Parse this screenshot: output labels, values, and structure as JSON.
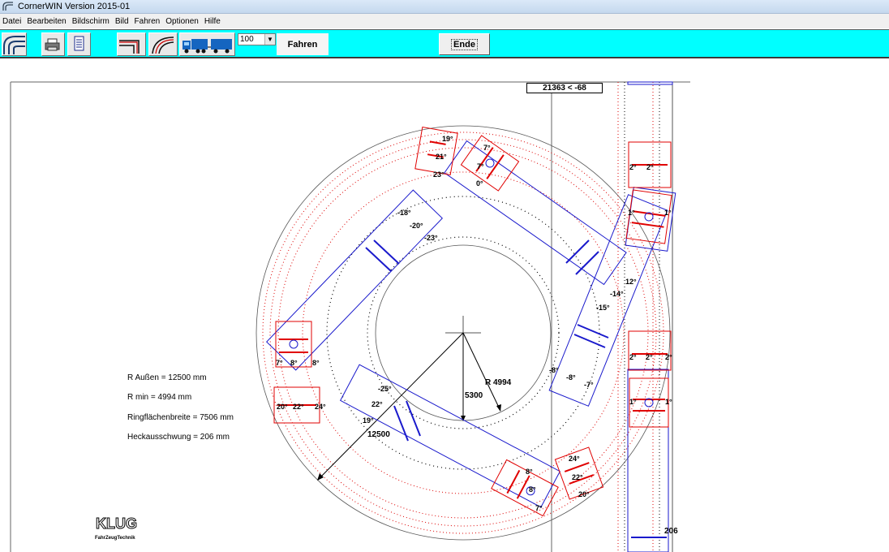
{
  "window": {
    "title": "CornerWIN  Version 2015-01"
  },
  "menu": [
    "Datei",
    "Bearbeiten",
    "Bildschirm",
    "Bild",
    "Fahren",
    "Optionen",
    "Hilfe"
  ],
  "toolbar": {
    "zoom_value": "100",
    "fahren_label": "Fahren",
    "ende_label": "Ende"
  },
  "readout": "21363 < -68",
  "info": {
    "r_aussen": "R Außen  =  12500 mm",
    "r_min": "R min = 4994 mm",
    "ringflaeche": "Ringflächenbreite = 7506 mm",
    "heckausschwung": "Heckausschwung = 206 mm"
  },
  "dimensions": {
    "r_min_label": "R 4994",
    "center_height": "5300",
    "r_outer_label": "12500",
    "rear_swing": "206"
  },
  "logo": {
    "name": "KLUG",
    "sub": "FahrZeugTechnik"
  },
  "angles": {
    "a1": "19°",
    "a2": "21°",
    "a3": "23°",
    "a4": "7°",
    "a5": "7°",
    "a6": "0°",
    "a7": "-18°",
    "a8": "-20°",
    "a9": "-23°",
    "a10": "2°",
    "a11": "2°",
    "a12": "1°",
    "a13": "1°",
    "a14": "12°",
    "a15": "-14°",
    "a16": "-15°",
    "a17": "7°",
    "a18": "8°",
    "a19": "-8°",
    "a20": "-8°",
    "a21": "-7°",
    "a22": "2°",
    "a23": "2°",
    "a24": "2°",
    "a25": "1°",
    "a26": "1°",
    "a27": "20°",
    "a28": "22°",
    "a29": "24°",
    "a30": "-25°",
    "a31": "22°",
    "a32": "19°",
    "a33": "24°",
    "a34": "22°",
    "a35": "20°",
    "a36": "8°",
    "a37": "8°",
    "a38": "7°",
    "a39": "8°"
  },
  "colors": {
    "toolbar": "#00ffff",
    "vehicle_body": "#0000cc",
    "wheels": "#e00000"
  }
}
